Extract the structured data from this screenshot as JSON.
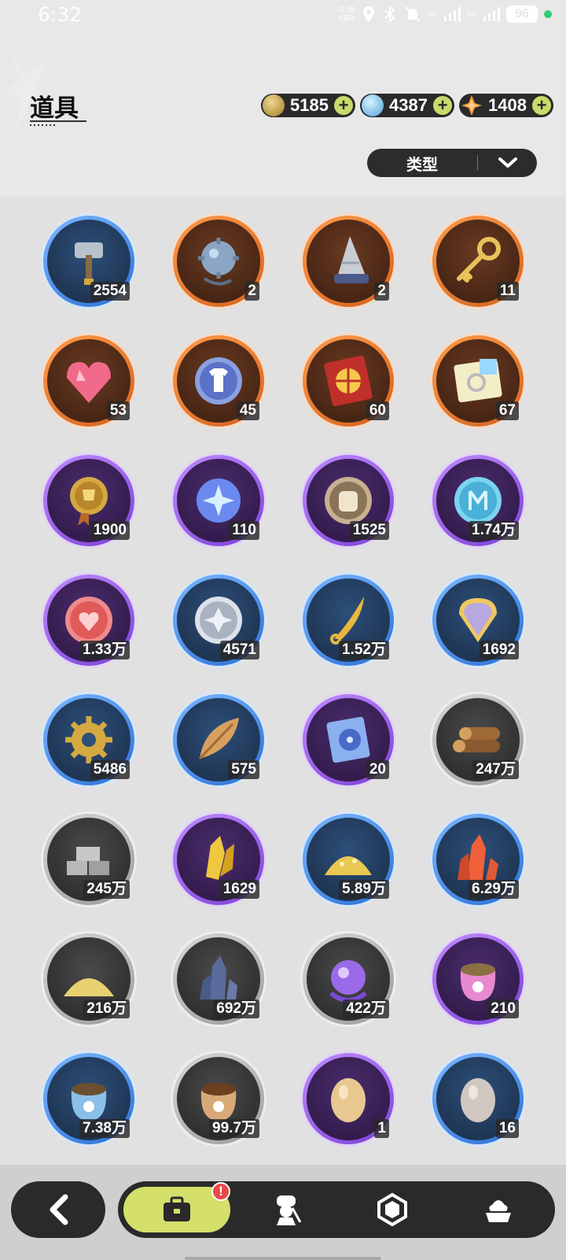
{
  "status_bar": {
    "time": "6:32",
    "net_speed": "0.39\nKB/s",
    "net_value": "0.39",
    "net_unit": "KB/s",
    "signal1": "5G",
    "signal2": "5G",
    "battery": "96"
  },
  "header": {
    "title": "道具"
  },
  "currencies": [
    {
      "icon": "gold-coin-icon",
      "value": "5185",
      "color": "#c9a24a"
    },
    {
      "icon": "crystal-icon",
      "value": "4387",
      "color": "#7fd4ff"
    },
    {
      "icon": "star-shard-icon",
      "value": "1408",
      "color": "#ff9a3c"
    }
  ],
  "filter": {
    "label": "类型"
  },
  "items": [
    {
      "icon": "hammer-icon",
      "count": "2554",
      "rarity": "blue"
    },
    {
      "icon": "spiked-mine-icon",
      "count": "2",
      "rarity": "orange"
    },
    {
      "icon": "drill-cone-icon",
      "count": "2",
      "rarity": "orange"
    },
    {
      "icon": "golden-key-icon",
      "count": "11",
      "rarity": "orange"
    },
    {
      "icon": "pink-gem-heart-icon",
      "count": "53",
      "rarity": "orange"
    },
    {
      "icon": "shirt-coin-icon",
      "count": "45",
      "rarity": "orange"
    },
    {
      "icon": "wheel-ticket-icon",
      "count": "60",
      "rarity": "orange"
    },
    {
      "icon": "rainbow-ticket-icon",
      "count": "67",
      "rarity": "orange"
    },
    {
      "icon": "trophy-medal-icon",
      "count": "1900",
      "rarity": "purple"
    },
    {
      "icon": "star-coin-icon",
      "count": "110",
      "rarity": "purple"
    },
    {
      "icon": "fist-coin-icon",
      "count": "1525",
      "rarity": "purple"
    },
    {
      "icon": "emblem-coin-icon",
      "count": "1.74万",
      "rarity": "purple"
    },
    {
      "icon": "heart-coin-icon",
      "count": "1.33万",
      "rarity": "purple"
    },
    {
      "icon": "silver-coin-icon",
      "count": "4571",
      "rarity": "blue"
    },
    {
      "icon": "golden-blade-icon",
      "count": "1.52万",
      "rarity": "blue"
    },
    {
      "icon": "scale-shell-icon",
      "count": "1692",
      "rarity": "blue"
    },
    {
      "icon": "gear-icon",
      "count": "5486",
      "rarity": "blue"
    },
    {
      "icon": "leaf-icon",
      "count": "575",
      "rarity": "blue"
    },
    {
      "icon": "disc-case-icon",
      "count": "20",
      "rarity": "purple"
    },
    {
      "icon": "wood-logs-icon",
      "count": "247万",
      "rarity": "gray"
    },
    {
      "icon": "stone-bricks-icon",
      "count": "245万",
      "rarity": "gray"
    },
    {
      "icon": "gold-crystal-icon",
      "count": "1629",
      "rarity": "purple"
    },
    {
      "icon": "gold-sand-pile-icon",
      "count": "5.89万",
      "rarity": "blue"
    },
    {
      "icon": "red-crystal-icon",
      "count": "6.29万",
      "rarity": "blue"
    },
    {
      "icon": "sand-pile-icon",
      "count": "216万",
      "rarity": "gray"
    },
    {
      "icon": "dark-crystal-icon",
      "count": "692万",
      "rarity": "gray"
    },
    {
      "icon": "purple-orb-icon",
      "count": "422万",
      "rarity": "gray"
    },
    {
      "icon": "pink-food-bag-icon",
      "count": "210",
      "rarity": "purple"
    },
    {
      "icon": "blue-food-bag-icon",
      "count": "7.38万",
      "rarity": "blue"
    },
    {
      "icon": "brown-food-bag-icon",
      "count": "99.7万",
      "rarity": "gray"
    },
    {
      "icon": "golden-egg-icon",
      "count": "1",
      "rarity": "purple"
    },
    {
      "icon": "gray-egg-icon",
      "count": "16",
      "rarity": "blue"
    }
  ],
  "nav": {
    "tabs": [
      {
        "icon": "backpack-icon",
        "active": true,
        "badge": "!"
      },
      {
        "icon": "chef-character-icon",
        "active": false
      },
      {
        "icon": "hexagon-gem-icon",
        "active": false
      },
      {
        "icon": "dessert-icon",
        "active": false
      }
    ]
  }
}
